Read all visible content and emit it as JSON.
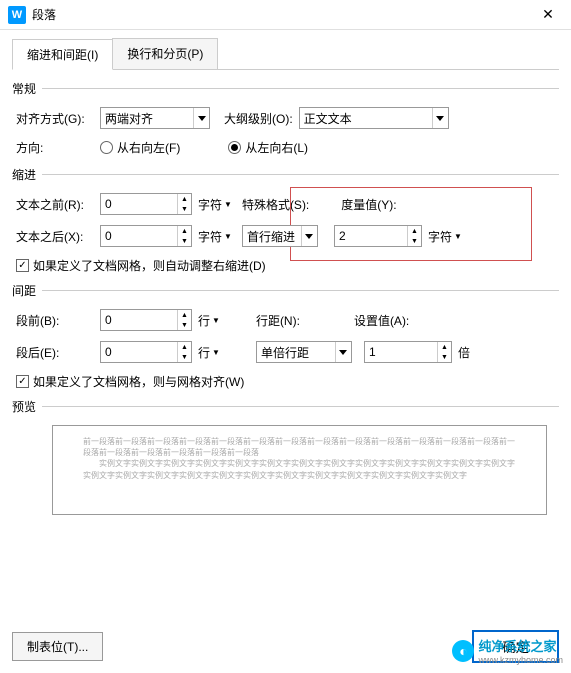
{
  "window": {
    "title": "段落"
  },
  "tabs": {
    "indent_spacing": "缩进和间距(I)",
    "line_page_breaks": "换行和分页(P)"
  },
  "general": {
    "section": "常规",
    "alignment_label": "对齐方式(G):",
    "alignment_value": "两端对齐",
    "outline_label": "大纲级别(O):",
    "outline_value": "正文文本",
    "direction_label": "方向:",
    "rtl": "从右向左(F)",
    "ltr": "从左向右(L)"
  },
  "indent": {
    "section": "缩进",
    "before_label": "文本之前(R):",
    "before_value": "0",
    "before_unit": "字符",
    "after_label": "文本之后(X):",
    "after_value": "0",
    "after_unit": "字符",
    "special_label": "特殊格式(S):",
    "special_value": "首行缩进",
    "measure_label": "度量值(Y):",
    "measure_value": "2",
    "measure_unit": "字符",
    "grid_check": "如果定义了文档网格，则自动调整右缩进(D)"
  },
  "spacing": {
    "section": "间距",
    "before_label": "段前(B):",
    "before_value": "0",
    "before_unit": "行",
    "after_label": "段后(E):",
    "after_value": "0",
    "after_unit": "行",
    "line_label": "行距(N):",
    "line_value": "单倍行距",
    "setat_label": "设置值(A):",
    "setat_value": "1",
    "setat_unit": "倍",
    "grid_check": "如果定义了文档网格，则与网格对齐(W)"
  },
  "preview": {
    "section": "预览",
    "placeholder_top": "前一段落前一段落前一段落前一段落前一段落前一段落前一段落前一段落前一段落前一段落前一段落前一段落前一段落前一段落前一段落前一段落前一段落前一段落前一段落",
    "placeholder_body": "实例文字实例文字实例文字实例文字实例文字实例文字实例文字实例文字实例文字实例文字实例文字实例文字实例文字实例文字实例文字实例文字实例文字实例文字实例文字实例文字实例文字实例文字实例文字实例文字实例文字"
  },
  "footer": {
    "tabs_btn": "制表位(T)...",
    "ok": "确定"
  },
  "watermark": {
    "text": "纯净系统之家",
    "url": "www.kzmyhome.com"
  }
}
